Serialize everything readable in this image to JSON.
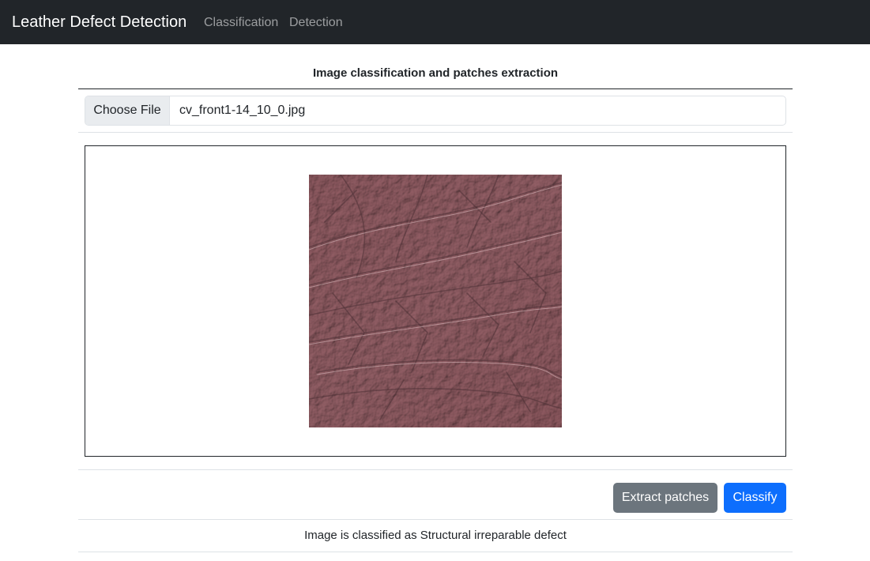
{
  "navbar": {
    "brand": "Leather Defect Detection",
    "links": [
      {
        "label": "Classification"
      },
      {
        "label": "Detection"
      }
    ]
  },
  "main": {
    "heading": "Image classification and patches extraction",
    "file_input": {
      "button_label": "Choose File",
      "file_name": "cv_front1-14_10_0.jpg"
    },
    "preview": {
      "image_description": "leather-texture"
    },
    "actions": {
      "extract_label": "Extract patches",
      "classify_label": "Classify"
    },
    "result_text": "Image is classified as Structural irreparable defect"
  },
  "colors": {
    "navbar_bg": "#212529",
    "secondary_button": "#6c757d",
    "primary_button": "#0d6efd",
    "leather_base": "#a98086"
  }
}
